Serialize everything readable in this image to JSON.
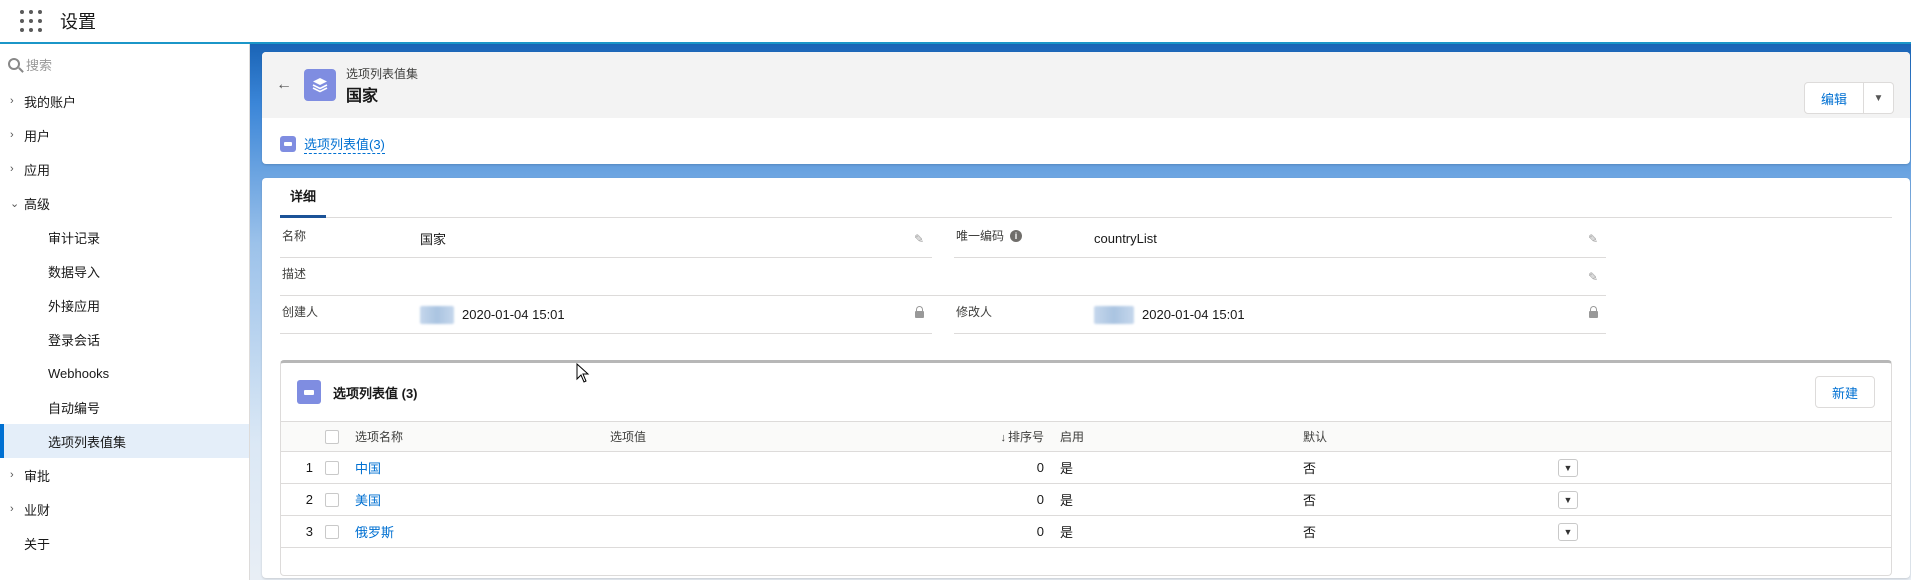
{
  "topbar": {
    "app_title": "设置"
  },
  "sidebar": {
    "search_placeholder": "搜索",
    "items": [
      {
        "label": "我的账户",
        "chevron": "›"
      },
      {
        "label": "用户",
        "chevron": "›"
      },
      {
        "label": "应用",
        "chevron": "›"
      },
      {
        "label": "高级",
        "chevron": "⌄"
      },
      {
        "label": "审计记录"
      },
      {
        "label": "数据导入"
      },
      {
        "label": "外接应用"
      },
      {
        "label": "登录会话"
      },
      {
        "label": "Webhooks"
      },
      {
        "label": "自动编号"
      },
      {
        "label": "选项列表值集"
      },
      {
        "label": "审批",
        "chevron": "›"
      },
      {
        "label": "业财",
        "chevron": "›"
      },
      {
        "label": "关于"
      }
    ]
  },
  "header": {
    "object_type": "选项列表值集",
    "record_name": "国家",
    "edit_label": "编辑",
    "related_link": "选项列表值(3)"
  },
  "detail": {
    "tab_label": "详细",
    "fields": {
      "name_label": "名称",
      "name_value": "国家",
      "unique_code_label": "唯一编码",
      "unique_code_value": "countryList",
      "description_label": "描述",
      "created_by_label": "创建人",
      "created_at": "2020-01-04 15:01",
      "modified_by_label": "修改人",
      "modified_at": "2020-01-04 15:01"
    }
  },
  "related_list": {
    "title": "选项列表值 (3)",
    "new_label": "新建",
    "columns": {
      "name": "选项名称",
      "value": "选项值",
      "sort": "排序号",
      "enabled": "启用",
      "default": "默认"
    },
    "rows": [
      {
        "num": "1",
        "name": "中国",
        "value": "",
        "sort": "0",
        "enabled": "是",
        "default": "否"
      },
      {
        "num": "2",
        "name": "美国",
        "value": "",
        "sort": "0",
        "enabled": "是",
        "default": "否"
      },
      {
        "num": "3",
        "name": "俄罗斯",
        "value": "",
        "sort": "0",
        "enabled": "是",
        "default": "否"
      }
    ]
  },
  "colors": {
    "accent": "#0070d2",
    "brand_bar": "#1b96c8",
    "icon_bg": "#7f8de1"
  }
}
